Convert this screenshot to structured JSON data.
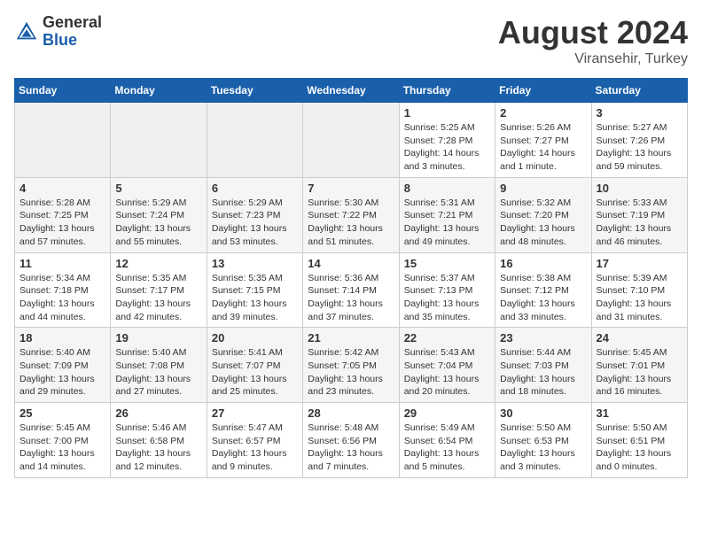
{
  "header": {
    "logo": {
      "general": "General",
      "blue": "Blue"
    },
    "title": "August 2024",
    "location": "Viransehir, Turkey"
  },
  "weekdays": [
    "Sunday",
    "Monday",
    "Tuesday",
    "Wednesday",
    "Thursday",
    "Friday",
    "Saturday"
  ],
  "rows": [
    [
      {
        "day": "",
        "info": ""
      },
      {
        "day": "",
        "info": ""
      },
      {
        "day": "",
        "info": ""
      },
      {
        "day": "",
        "info": ""
      },
      {
        "day": "1",
        "info": "Sunrise: 5:25 AM\nSunset: 7:28 PM\nDaylight: 14 hours\nand 3 minutes."
      },
      {
        "day": "2",
        "info": "Sunrise: 5:26 AM\nSunset: 7:27 PM\nDaylight: 14 hours\nand 1 minute."
      },
      {
        "day": "3",
        "info": "Sunrise: 5:27 AM\nSunset: 7:26 PM\nDaylight: 13 hours\nand 59 minutes."
      }
    ],
    [
      {
        "day": "4",
        "info": "Sunrise: 5:28 AM\nSunset: 7:25 PM\nDaylight: 13 hours\nand 57 minutes."
      },
      {
        "day": "5",
        "info": "Sunrise: 5:29 AM\nSunset: 7:24 PM\nDaylight: 13 hours\nand 55 minutes."
      },
      {
        "day": "6",
        "info": "Sunrise: 5:29 AM\nSunset: 7:23 PM\nDaylight: 13 hours\nand 53 minutes."
      },
      {
        "day": "7",
        "info": "Sunrise: 5:30 AM\nSunset: 7:22 PM\nDaylight: 13 hours\nand 51 minutes."
      },
      {
        "day": "8",
        "info": "Sunrise: 5:31 AM\nSunset: 7:21 PM\nDaylight: 13 hours\nand 49 minutes."
      },
      {
        "day": "9",
        "info": "Sunrise: 5:32 AM\nSunset: 7:20 PM\nDaylight: 13 hours\nand 48 minutes."
      },
      {
        "day": "10",
        "info": "Sunrise: 5:33 AM\nSunset: 7:19 PM\nDaylight: 13 hours\nand 46 minutes."
      }
    ],
    [
      {
        "day": "11",
        "info": "Sunrise: 5:34 AM\nSunset: 7:18 PM\nDaylight: 13 hours\nand 44 minutes."
      },
      {
        "day": "12",
        "info": "Sunrise: 5:35 AM\nSunset: 7:17 PM\nDaylight: 13 hours\nand 42 minutes."
      },
      {
        "day": "13",
        "info": "Sunrise: 5:35 AM\nSunset: 7:15 PM\nDaylight: 13 hours\nand 39 minutes."
      },
      {
        "day": "14",
        "info": "Sunrise: 5:36 AM\nSunset: 7:14 PM\nDaylight: 13 hours\nand 37 minutes."
      },
      {
        "day": "15",
        "info": "Sunrise: 5:37 AM\nSunset: 7:13 PM\nDaylight: 13 hours\nand 35 minutes."
      },
      {
        "day": "16",
        "info": "Sunrise: 5:38 AM\nSunset: 7:12 PM\nDaylight: 13 hours\nand 33 minutes."
      },
      {
        "day": "17",
        "info": "Sunrise: 5:39 AM\nSunset: 7:10 PM\nDaylight: 13 hours\nand 31 minutes."
      }
    ],
    [
      {
        "day": "18",
        "info": "Sunrise: 5:40 AM\nSunset: 7:09 PM\nDaylight: 13 hours\nand 29 minutes."
      },
      {
        "day": "19",
        "info": "Sunrise: 5:40 AM\nSunset: 7:08 PM\nDaylight: 13 hours\nand 27 minutes."
      },
      {
        "day": "20",
        "info": "Sunrise: 5:41 AM\nSunset: 7:07 PM\nDaylight: 13 hours\nand 25 minutes."
      },
      {
        "day": "21",
        "info": "Sunrise: 5:42 AM\nSunset: 7:05 PM\nDaylight: 13 hours\nand 23 minutes."
      },
      {
        "day": "22",
        "info": "Sunrise: 5:43 AM\nSunset: 7:04 PM\nDaylight: 13 hours\nand 20 minutes."
      },
      {
        "day": "23",
        "info": "Sunrise: 5:44 AM\nSunset: 7:03 PM\nDaylight: 13 hours\nand 18 minutes."
      },
      {
        "day": "24",
        "info": "Sunrise: 5:45 AM\nSunset: 7:01 PM\nDaylight: 13 hours\nand 16 minutes."
      }
    ],
    [
      {
        "day": "25",
        "info": "Sunrise: 5:45 AM\nSunset: 7:00 PM\nDaylight: 13 hours\nand 14 minutes."
      },
      {
        "day": "26",
        "info": "Sunrise: 5:46 AM\nSunset: 6:58 PM\nDaylight: 13 hours\nand 12 minutes."
      },
      {
        "day": "27",
        "info": "Sunrise: 5:47 AM\nSunset: 6:57 PM\nDaylight: 13 hours\nand 9 minutes."
      },
      {
        "day": "28",
        "info": "Sunrise: 5:48 AM\nSunset: 6:56 PM\nDaylight: 13 hours\nand 7 minutes."
      },
      {
        "day": "29",
        "info": "Sunrise: 5:49 AM\nSunset: 6:54 PM\nDaylight: 13 hours\nand 5 minutes."
      },
      {
        "day": "30",
        "info": "Sunrise: 5:50 AM\nSunset: 6:53 PM\nDaylight: 13 hours\nand 3 minutes."
      },
      {
        "day": "31",
        "info": "Sunrise: 5:50 AM\nSunset: 6:51 PM\nDaylight: 13 hours\nand 0 minutes."
      }
    ]
  ]
}
